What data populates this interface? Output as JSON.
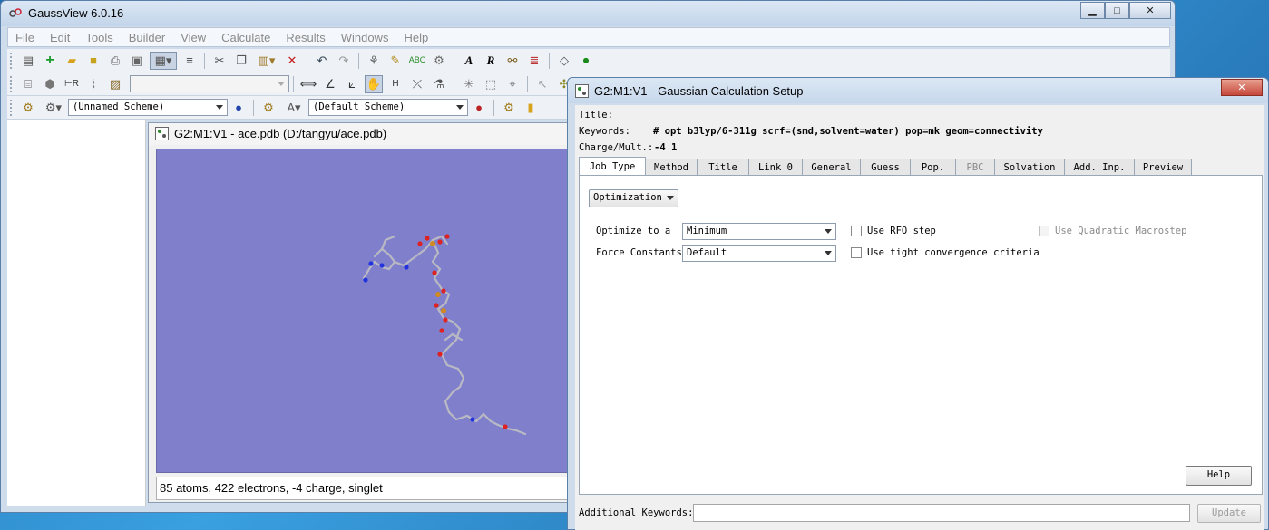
{
  "main_window": {
    "title": "GaussView 6.0.16",
    "menu": [
      "File",
      "Edit",
      "Tools",
      "Builder",
      "View",
      "Calculate",
      "Results",
      "Windows",
      "Help"
    ],
    "toolbar": {
      "scheme_combo_1": "(Unnamed Scheme)",
      "scheme_combo_2": "(Default Scheme)"
    }
  },
  "molecule_window": {
    "title": "G2:M1:V1 - ace.pdb (D:/tangyu/ace.pdb)",
    "status": "85 atoms, 422 electrons, -4 charge, singlet",
    "background_color": "#7f7fcc"
  },
  "dialog": {
    "title": "G2:M1:V1 - Gaussian Calculation Setup",
    "title_label": "Title:",
    "keywords_label": "Keywords:",
    "keywords_value": "# opt b3lyp/6-311g scrf=(smd,solvent=water) pop=mk geom=connectivity",
    "charge_label": "Charge/Mult.:",
    "charge_value": "-4 1",
    "tabs": [
      {
        "label": "Job Type",
        "active": true
      },
      {
        "label": "Method"
      },
      {
        "label": "Title"
      },
      {
        "label": "Link 0"
      },
      {
        "label": "General"
      },
      {
        "label": "Guess"
      },
      {
        "label": "Pop."
      },
      {
        "label": "PBC",
        "disabled": true
      },
      {
        "label": "Solvation"
      },
      {
        "label": "Add. Inp."
      },
      {
        "label": "Preview"
      }
    ],
    "job_type": {
      "job_select": "Optimization",
      "optimize_label": "Optimize to a",
      "optimize_value": "Minimum",
      "force_label": "Force Constants",
      "force_value": "Default",
      "rfo_label": "Use RFO step",
      "tight_label": "Use tight convergence criteria",
      "quadratic_label": "Use Quadratic Macrostep"
    },
    "help_button": "Help",
    "additional_keywords_label": "Additional Keywords:",
    "additional_keywords_value": "",
    "update_button": "Update"
  }
}
